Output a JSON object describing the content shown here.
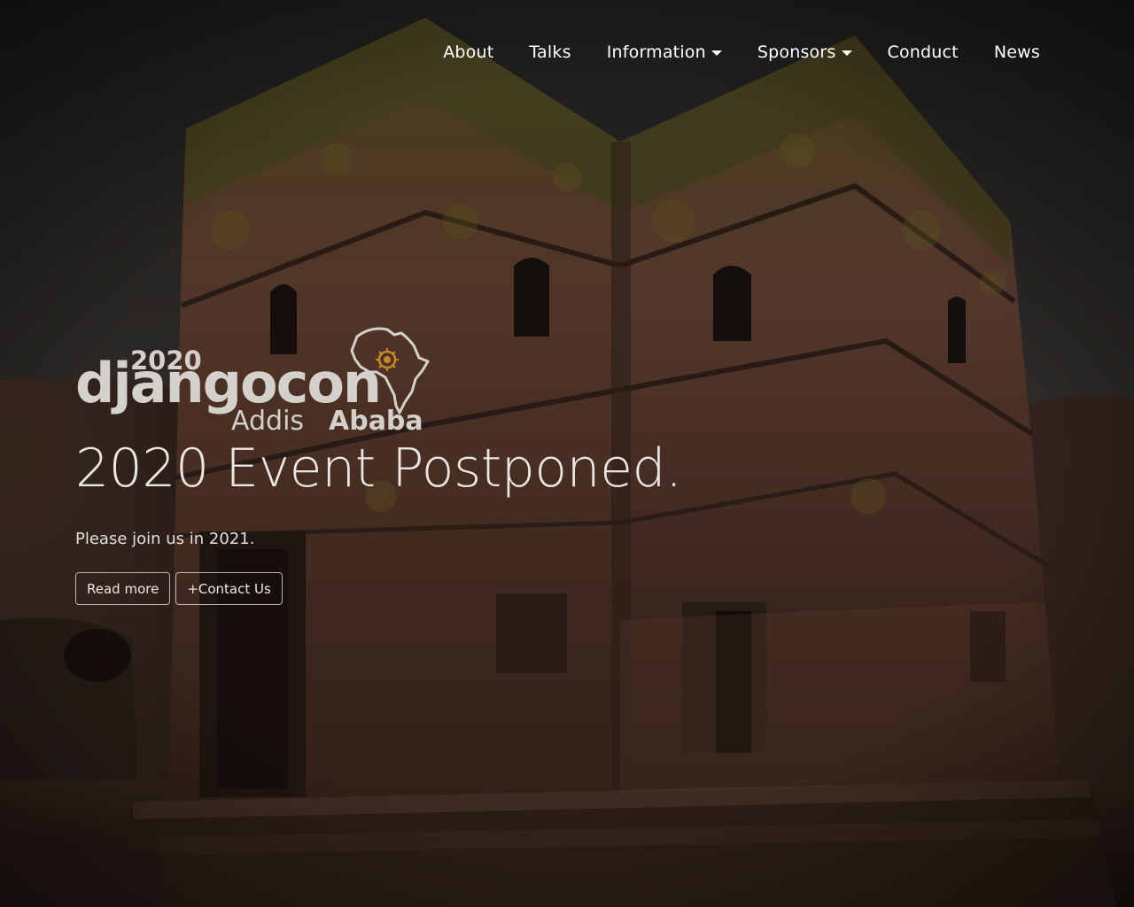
{
  "nav": {
    "items": [
      {
        "label": "About",
        "dropdown": false
      },
      {
        "label": "Talks",
        "dropdown": false
      },
      {
        "label": "Information",
        "dropdown": true
      },
      {
        "label": "Sponsors",
        "dropdown": true
      },
      {
        "label": "Conduct",
        "dropdown": false
      },
      {
        "label": "News",
        "dropdown": false
      }
    ]
  },
  "logo": {
    "year": "2020",
    "word": "djangocon",
    "city_first": "Addis",
    "city_second": "Ababa",
    "icon": "africa-outline-icon",
    "accent_color": "#c48a2a"
  },
  "hero": {
    "title": "2020 Event Postponed.",
    "subtitle": "Please join us in 2021.",
    "buttons": {
      "read_more": "Read more",
      "contact": "+Contact Us"
    }
  },
  "colors": {
    "text": "#ffffff",
    "logo_text": "#d4d0cc",
    "sky": "#3a3633",
    "stone": "#7a4e3c",
    "moss": "#8a7a2a"
  }
}
